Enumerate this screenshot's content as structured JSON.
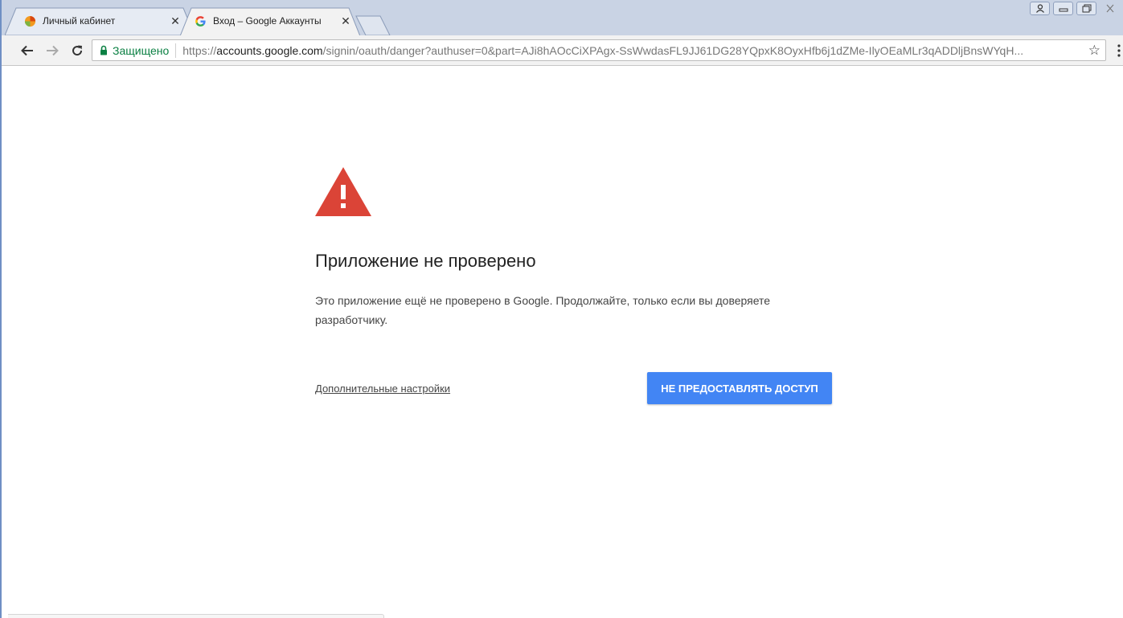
{
  "tabs": [
    {
      "title": "Личный кабинет",
      "active": false,
      "close": "✕"
    },
    {
      "title": "Вход – Google Аккаунты",
      "active": true,
      "close": "✕"
    }
  ],
  "toolbar": {
    "back_icon": "arrow-left-icon",
    "forward_icon": "arrow-right-icon",
    "reload_icon": "reload-icon",
    "secure_label": "Защищено",
    "url_scheme": "https://",
    "url_host": "accounts.google.com",
    "url_rest": "/signin/oauth/danger?authuser=0&part=AJi8hAOcCiXPAgx-SsWwdasFL9JJ61DG28YQpxK8OyxHfb6j1dZMe-IlyOEaMLr3qADDljBnsWYqH...",
    "bookmark_icon": "star-icon"
  },
  "page": {
    "heading": "Приложение не проверено",
    "description": "Это приложение ещё не проверено в Google. Продолжайте, только если вы доверяете разработчику.",
    "advanced_link": "Дополнительные настройки",
    "deny_button": "НЕ ПРЕДОСТАВЛЯТЬ ДОСТУП"
  },
  "colors": {
    "warning_red": "#db4437",
    "button_blue": "#4285f4",
    "secure_green": "#0b8043"
  }
}
